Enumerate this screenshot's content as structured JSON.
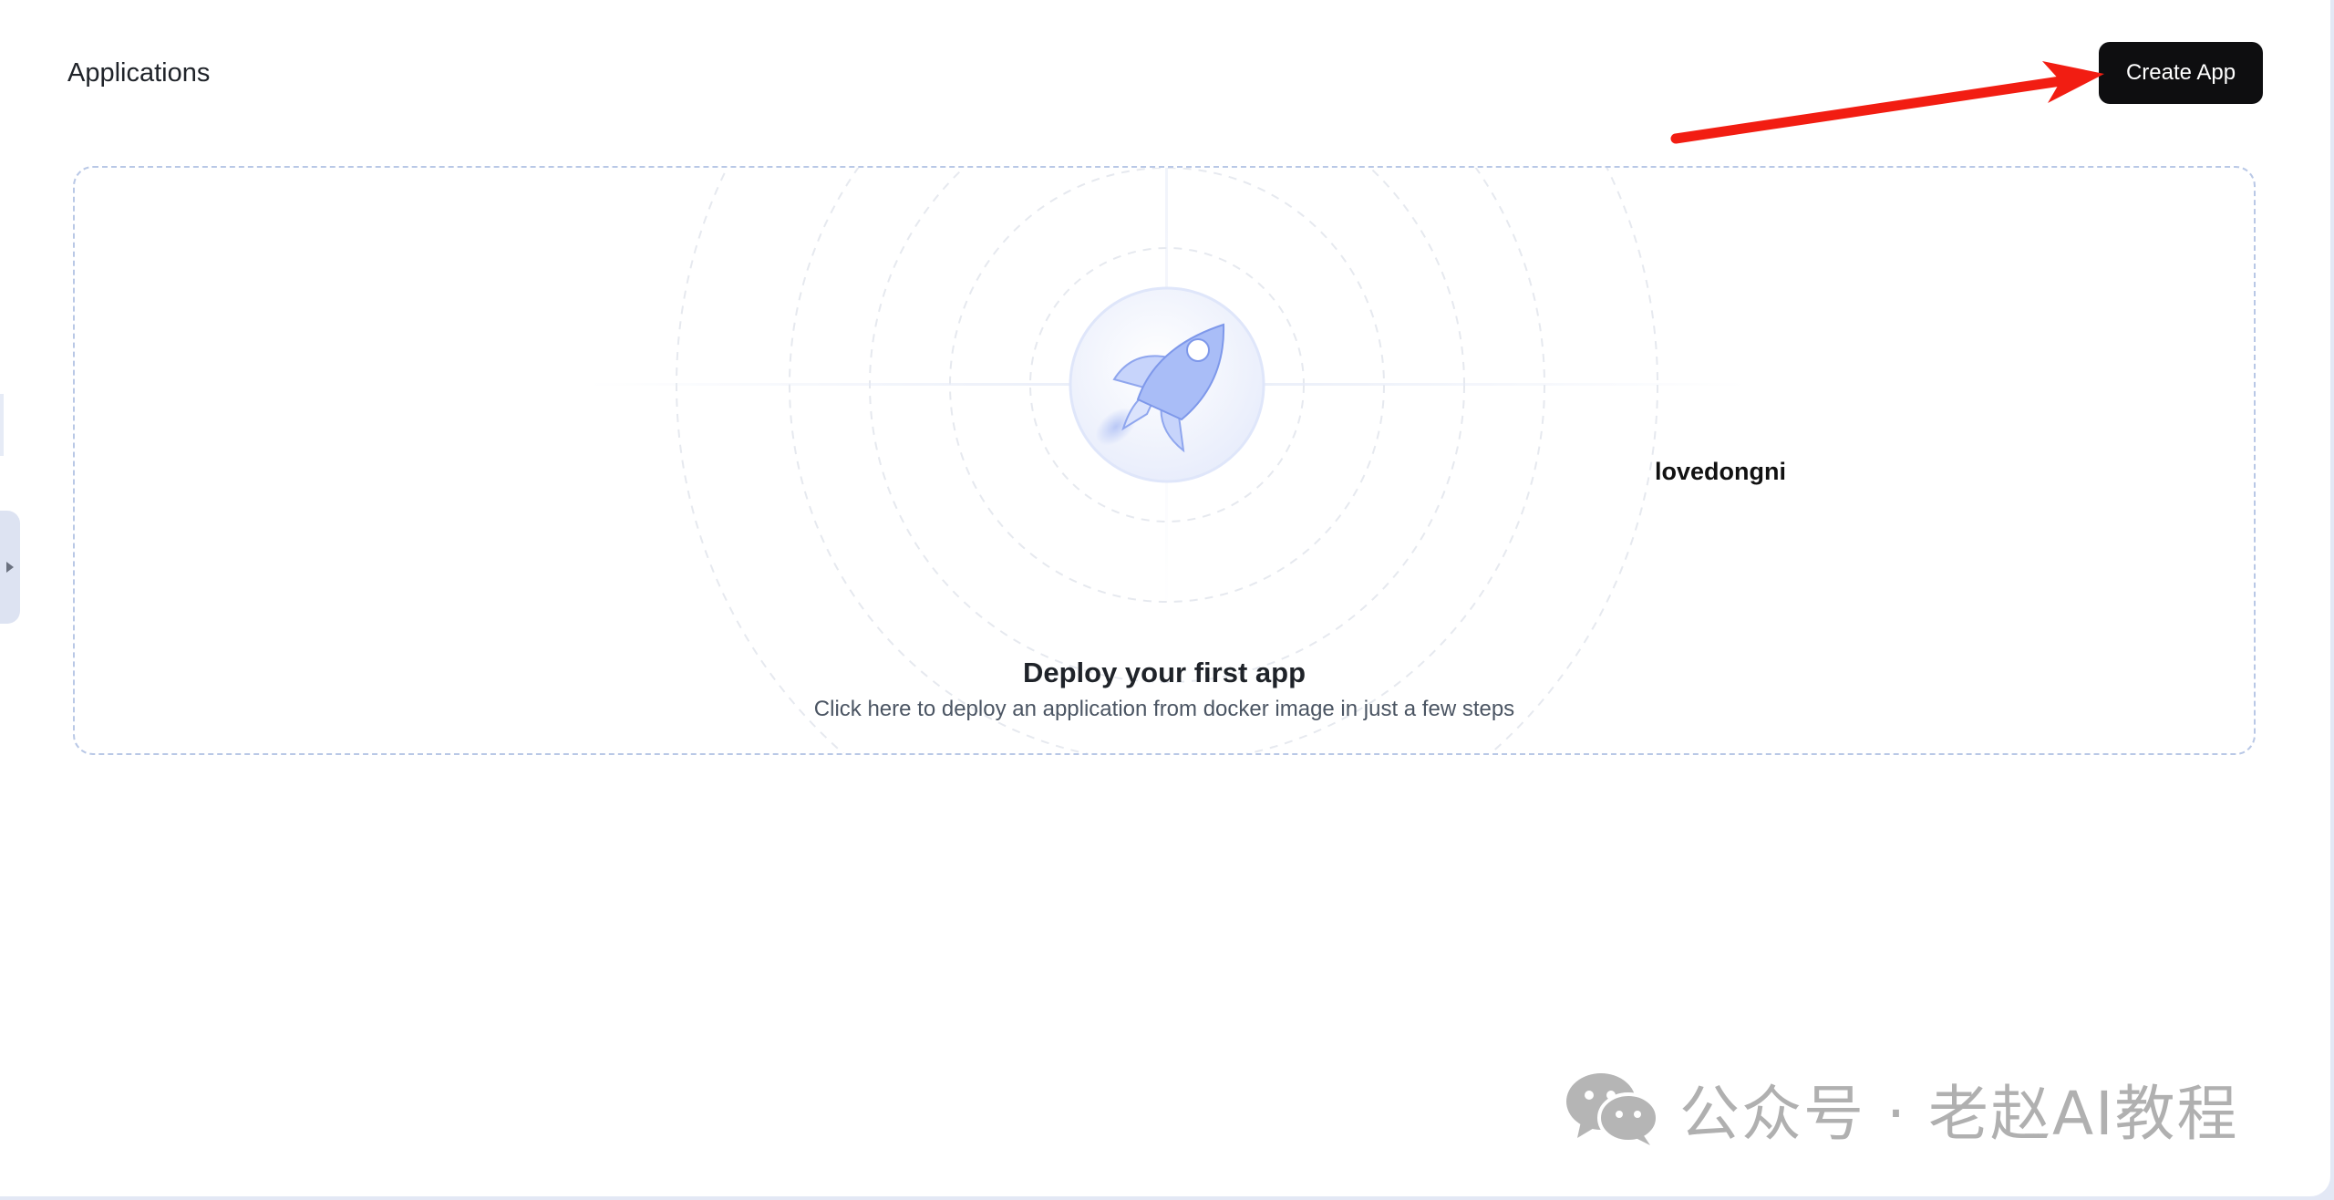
{
  "page": {
    "title": "Applications",
    "create_button_label": "Create App"
  },
  "empty_state": {
    "heading": "Deploy your first app",
    "description": "Click here to deploy an application from docker image in just a few steps",
    "icon": "rocket-icon"
  },
  "overlay": {
    "label": "lovedongni",
    "watermark_text": "公众号 · 老赵AI教程",
    "watermark_icon": "wechat-icon",
    "arrow_color": "#f21d12"
  },
  "colors": {
    "button_bg": "#0e0e10",
    "accent_blue": "#9db3f2",
    "card_border": "#b9c8e6"
  }
}
